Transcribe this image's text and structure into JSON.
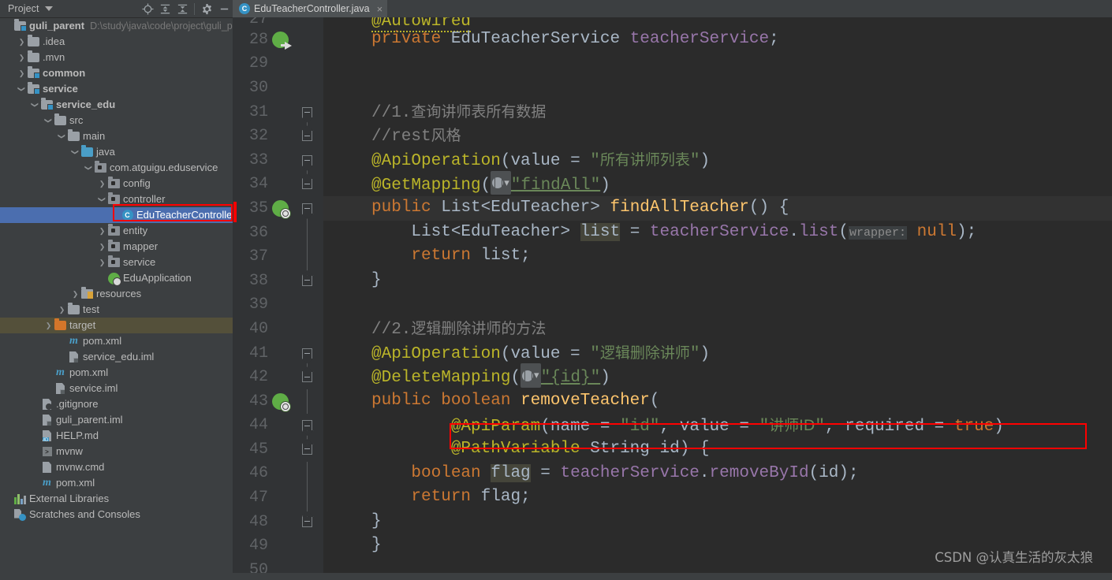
{
  "window": {
    "theme_bg": "#2b2b2b",
    "panel_bg": "#3c3f41",
    "accent_selection": "#4b6eaf",
    "annotation_color": "#ff0000"
  },
  "project_panel": {
    "title": "Project",
    "toolbar": [
      {
        "name": "locate-icon",
        "label": "Select Opened File"
      },
      {
        "name": "expand-all-icon",
        "label": "Expand All"
      },
      {
        "name": "collapse-all-icon",
        "label": "Collapse All"
      },
      {
        "name": "gear-icon",
        "label": "Options"
      },
      {
        "name": "minimize-icon",
        "label": "Hide"
      }
    ],
    "tree": [
      {
        "label": "guli_parent",
        "sub": "D:\\study\\java\\code\\project\\guli_pa",
        "icon": "module-folder-icon",
        "indent": 0,
        "arrow": "none",
        "bold": true
      },
      {
        "label": ".idea",
        "icon": "folder-icon",
        "indent": 1,
        "arrow": "collapsed"
      },
      {
        "label": ".mvn",
        "icon": "folder-icon",
        "indent": 1,
        "arrow": "collapsed"
      },
      {
        "label": "common",
        "icon": "module-folder-icon",
        "indent": 1,
        "arrow": "collapsed",
        "bold": true
      },
      {
        "label": "service",
        "icon": "module-folder-icon",
        "indent": 1,
        "arrow": "expanded",
        "bold": true
      },
      {
        "label": "service_edu",
        "icon": "module-folder-icon",
        "indent": 2,
        "arrow": "expanded",
        "bold": true
      },
      {
        "label": "src",
        "icon": "folder-icon",
        "indent": 3,
        "arrow": "expanded"
      },
      {
        "label": "main",
        "icon": "folder-icon",
        "indent": 4,
        "arrow": "expanded"
      },
      {
        "label": "java",
        "icon": "source-folder-icon",
        "indent": 5,
        "arrow": "expanded"
      },
      {
        "label": "com.atguigu.eduservice",
        "icon": "package-icon",
        "indent": 6,
        "arrow": "expanded"
      },
      {
        "label": "config",
        "icon": "package-icon",
        "indent": 7,
        "arrow": "collapsed"
      },
      {
        "label": "controller",
        "icon": "package-icon",
        "indent": 7,
        "arrow": "expanded"
      },
      {
        "label": "EduTeacherController",
        "icon": "java-class-icon",
        "indent": 8,
        "arrow": "none",
        "selected": true,
        "highlighted": true
      },
      {
        "label": "entity",
        "icon": "package-icon",
        "indent": 7,
        "arrow": "collapsed"
      },
      {
        "label": "mapper",
        "icon": "package-icon",
        "indent": 7,
        "arrow": "collapsed"
      },
      {
        "label": "service",
        "icon": "package-icon",
        "indent": 7,
        "arrow": "collapsed"
      },
      {
        "label": "EduApplication",
        "icon": "spring-boot-class-icon",
        "indent": 7,
        "arrow": "none"
      },
      {
        "label": "resources",
        "icon": "resources-folder-icon",
        "indent": 5,
        "arrow": "collapsed"
      },
      {
        "label": "test",
        "icon": "folder-icon",
        "indent": 4,
        "arrow": "collapsed"
      },
      {
        "label": "target",
        "icon": "target-folder-icon",
        "indent": 3,
        "arrow": "collapsed",
        "row_highlight": true
      },
      {
        "label": "pom.xml",
        "icon": "maven-icon",
        "indent": 4,
        "arrow": "none"
      },
      {
        "label": "service_edu.iml",
        "icon": "iml-file-icon",
        "indent": 4,
        "arrow": "none"
      },
      {
        "label": "pom.xml",
        "icon": "maven-icon",
        "indent": 3,
        "arrow": "none"
      },
      {
        "label": "service.iml",
        "icon": "iml-file-icon",
        "indent": 3,
        "arrow": "none"
      },
      {
        "label": ".gitignore",
        "icon": "gitignore-file-icon",
        "indent": 2,
        "arrow": "none"
      },
      {
        "label": "guli_parent.iml",
        "icon": "iml-file-icon",
        "indent": 2,
        "arrow": "none"
      },
      {
        "label": "HELP.md",
        "icon": "markdown-file-icon",
        "indent": 2,
        "arrow": "none"
      },
      {
        "label": "mvnw",
        "icon": "shell-file-icon",
        "indent": 2,
        "arrow": "none"
      },
      {
        "label": "mvnw.cmd",
        "icon": "cmd-file-icon",
        "indent": 2,
        "arrow": "none"
      },
      {
        "label": "pom.xml",
        "icon": "maven-icon",
        "indent": 2,
        "arrow": "none"
      },
      {
        "label": "External Libraries",
        "icon": "libraries-icon",
        "indent": 0,
        "arrow": "none"
      },
      {
        "label": "Scratches and Consoles",
        "icon": "scratches-icon",
        "indent": 0,
        "arrow": "none"
      }
    ]
  },
  "editor": {
    "tab": {
      "label": "EduTeacherController.java",
      "icon": "java-class-icon",
      "close": "×"
    },
    "lines": [
      {
        "num": "27",
        "text": "@Autowired"
      },
      {
        "num": "28",
        "text": "private EduTeacherService teacherService;",
        "gutter_icon": "spring-bean-autowired-icon"
      },
      {
        "num": "29",
        "text": ""
      },
      {
        "num": "30",
        "text": ""
      },
      {
        "num": "31",
        "text": "//1.查询讲师表所有数据"
      },
      {
        "num": "32",
        "text": "//rest风格"
      },
      {
        "num": "33",
        "text": "@ApiOperation(value = \"所有讲师列表\")"
      },
      {
        "num": "34",
        "text": "@GetMapping(\"findAll\")"
      },
      {
        "num": "35",
        "text": "public List<EduTeacher> findAllTeacher() {",
        "gutter_icon": "spring-request-mapping-icon",
        "caret": true
      },
      {
        "num": "36",
        "text": "    List<EduTeacher> list = teacherService.list(wrapper: null);"
      },
      {
        "num": "37",
        "text": "    return list;"
      },
      {
        "num": "38",
        "text": "}"
      },
      {
        "num": "39",
        "text": ""
      },
      {
        "num": "40",
        "text": "//2.逻辑删除讲师的方法"
      },
      {
        "num": "41",
        "text": "@ApiOperation(value = \"逻辑删除讲师\")"
      },
      {
        "num": "42",
        "text": "@DeleteMapping(\"{id}\")"
      },
      {
        "num": "43",
        "text": "public boolean removeTeacher(",
        "gutter_icon": "spring-request-mapping-icon"
      },
      {
        "num": "44",
        "text": "        @ApiParam(name = \"id\", value = \"讲师ID\", required = true)"
      },
      {
        "num": "45",
        "text": "        @PathVariable String id) {"
      },
      {
        "num": "46",
        "text": "    boolean flag = teacherService.removeById(id);"
      },
      {
        "num": "47",
        "text": "    return flag;"
      },
      {
        "num": "48",
        "text": "}"
      },
      {
        "num": "49",
        "text": "}"
      },
      {
        "num": "50",
        "text": ""
      }
    ],
    "inlay_hints": [
      "wrapper:"
    ],
    "highlighted_identifiers": [
      "list",
      "flag"
    ]
  },
  "annotations": {
    "boxes": [
      {
        "name": "tree-file-highlight-box",
        "target": "EduTeacherController"
      },
      {
        "name": "apiparam-highlight-box",
        "target": "@ApiParam(name = \"id\", value = \"讲师ID\", required = true)"
      }
    ]
  },
  "watermark": {
    "text": "CSDN @认真生活的灰太狼"
  }
}
